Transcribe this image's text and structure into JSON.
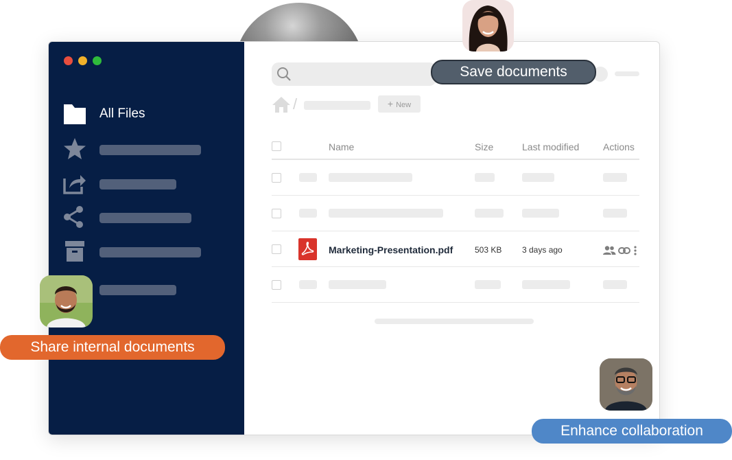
{
  "sidebar": {
    "items": [
      {
        "icon": "folder-icon",
        "label": "All Files"
      },
      {
        "icon": "star-icon",
        "label": ""
      },
      {
        "icon": "share-out-icon",
        "label": ""
      },
      {
        "icon": "share-icon",
        "label": ""
      },
      {
        "icon": "archive-icon",
        "label": ""
      },
      {
        "icon": "",
        "label": ""
      }
    ]
  },
  "toolbar": {
    "new_label": "New"
  },
  "table": {
    "headers": {
      "name": "Name",
      "size": "Size",
      "modified": "Last modified",
      "actions": "Actions"
    },
    "file": {
      "name": "Marketing-Presentation.pdf",
      "size": "503 KB",
      "modified": "3 days ago",
      "icon": "pdf-icon"
    }
  },
  "callouts": {
    "save": "Save documents",
    "share": "Share internal documents",
    "collab": "Enhance collaboration"
  },
  "colors": {
    "sidebar": "#061e45",
    "save_pill": "#525e6b",
    "share_pill": "#e2672d",
    "collab_pill": "#4f87c8",
    "pdf_red": "#d9342b"
  }
}
